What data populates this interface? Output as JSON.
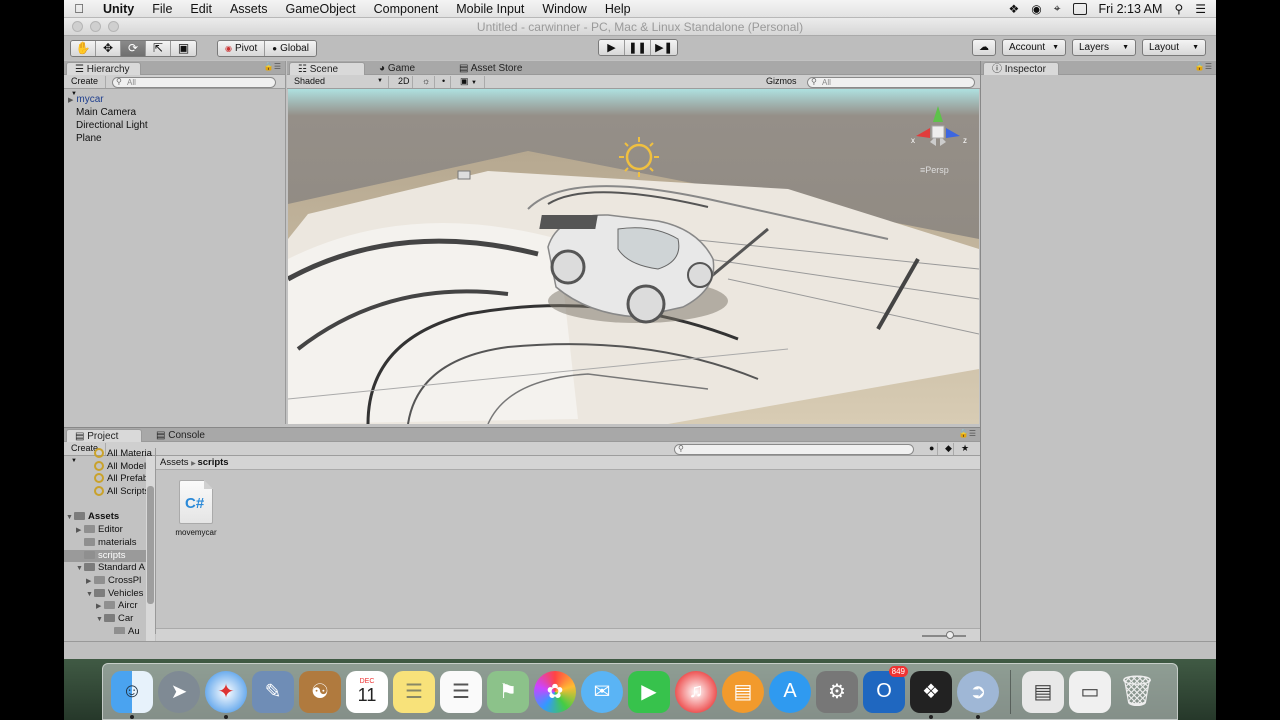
{
  "menubar": {
    "items": [
      "Unity",
      "File",
      "Edit",
      "Assets",
      "GameObject",
      "Component",
      "Mobile Input",
      "Window",
      "Help"
    ],
    "clock": "Fri 2:13 AM"
  },
  "window": {
    "title": "Untitled - carwinner - PC, Mac & Linux Standalone (Personal)"
  },
  "toolbar": {
    "pivot_label": "Pivot",
    "global_label": "Global",
    "account_label": "Account",
    "layers_label": "Layers",
    "layout_label": "Layout"
  },
  "hierarchy": {
    "tab_label": "Hierarchy",
    "create_label": "Create",
    "search_placeholder": "All",
    "items": [
      "mycar",
      "Main Camera",
      "Directional Light",
      "Plane"
    ]
  },
  "scene": {
    "tabs": [
      "Scene",
      "Game",
      "Asset Store"
    ],
    "shading_mode": "Shaded",
    "toggle_2d": "2D",
    "gizmos_label": "Gizmos",
    "search_placeholder": "All",
    "projection_label": "Persp",
    "axis_x": "x",
    "axis_z": "z"
  },
  "inspector": {
    "tab_label": "Inspector"
  },
  "project": {
    "tabs": [
      "Project",
      "Console"
    ],
    "create_label": "Create",
    "tree": [
      {
        "label": "All Materia",
        "indent": 2,
        "type": "search"
      },
      {
        "label": "All Models",
        "indent": 2,
        "type": "search"
      },
      {
        "label": "All Prefabs",
        "indent": 2,
        "type": "search"
      },
      {
        "label": "All Scripts",
        "indent": 2,
        "type": "search"
      },
      {
        "label": "",
        "indent": 0,
        "type": "blank"
      },
      {
        "label": "Assets",
        "indent": 0,
        "type": "folder-open",
        "bold": true
      },
      {
        "label": "Editor",
        "indent": 1,
        "type": "folder",
        "arrow": "▶"
      },
      {
        "label": "materials",
        "indent": 1,
        "type": "folder"
      },
      {
        "label": "scripts",
        "indent": 1,
        "type": "folder",
        "selected": true
      },
      {
        "label": "Standard A",
        "indent": 1,
        "type": "folder-open",
        "arrow": "▼"
      },
      {
        "label": "CrossPl",
        "indent": 2,
        "type": "folder",
        "arrow": "▶"
      },
      {
        "label": "Vehicles",
        "indent": 2,
        "type": "folder-open",
        "arrow": "▼"
      },
      {
        "label": "Aircr",
        "indent": 3,
        "type": "folder",
        "arrow": "▶"
      },
      {
        "label": "Car",
        "indent": 3,
        "type": "folder-open",
        "arrow": "▼"
      },
      {
        "label": "Au",
        "indent": 4,
        "type": "folder"
      }
    ],
    "breadcrumb_root": "Assets",
    "breadcrumb_current": "scripts",
    "asset_name": "movemycar",
    "asset_glyph": "C#"
  },
  "dock": {
    "outlook_badge": "849",
    "calendar_month": "DEC",
    "calendar_day": "11",
    "apps": [
      "finder",
      "launchpad",
      "safari",
      "preview",
      "contacts",
      "calendar",
      "notes",
      "reminders",
      "maps",
      "photos",
      "messages",
      "facetime",
      "itunes",
      "ibooks",
      "app-store",
      "system-preferences",
      "outlook",
      "unity",
      "remote-desktop"
    ]
  },
  "colors": {
    "selection": "#9a9a9a",
    "hierarchy_root": "#1f3f8f",
    "cs_blue": "#2c8ad8",
    "badge_red": "#e33333"
  }
}
